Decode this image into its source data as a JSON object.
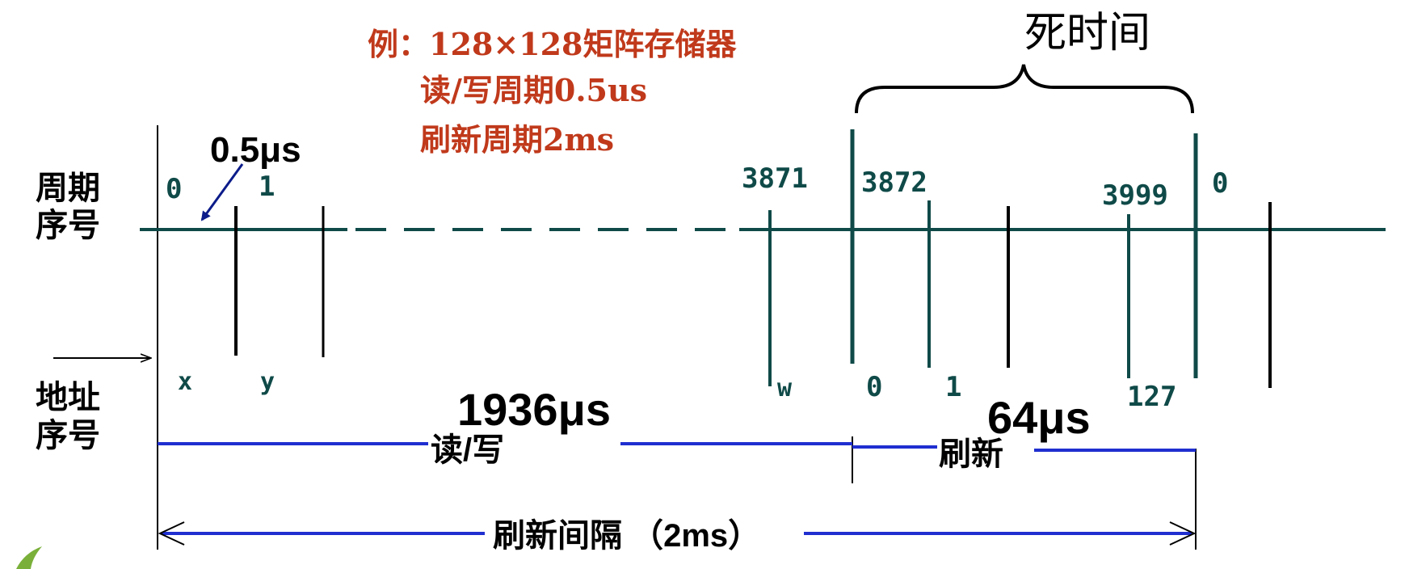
{
  "example": {
    "line1": "例：128×128矩阵存储器",
    "line2": "读/写周期0.5us",
    "line3": "刷新周期2ms"
  },
  "dead_time_label": "死时间",
  "row_labels": {
    "cycle_line1": "周期",
    "cycle_line2": "序号",
    "addr_line1": "地址",
    "addr_line2": "序号"
  },
  "cycle_numbers": [
    "0",
    "1",
    "3871",
    "3872",
    "3999",
    "0"
  ],
  "address_labels": [
    "x",
    "y",
    "w",
    "0",
    "1",
    "127"
  ],
  "callouts": {
    "cycle_time": "0.5μs",
    "rw_time": "1936μs",
    "refresh_time": "64μs"
  },
  "segments": {
    "rw": "读/写",
    "refresh": "刷新",
    "interval": "刷新间隔 （2ms）"
  },
  "colors": {
    "timeline": "#0f4a48",
    "example_text": "#c0391b",
    "span_blue": "#1f2fd0",
    "callout_arrow": "#0c1c8a",
    "ink": "#000000"
  }
}
